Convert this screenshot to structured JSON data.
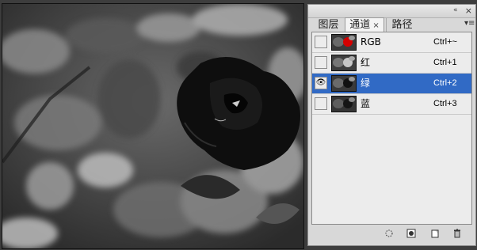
{
  "panel": {
    "tabs": [
      {
        "label": "图层"
      },
      {
        "label": "通道"
      },
      {
        "label": "路径"
      }
    ],
    "tab_close": "×",
    "panel_close": "×",
    "collapse": "«",
    "menu": "▾≡",
    "channels": [
      {
        "name": "RGB",
        "shortcut": "Ctrl+~",
        "visible": false,
        "selected": false
      },
      {
        "name": "红",
        "shortcut": "Ctrl+1",
        "visible": false,
        "selected": false
      },
      {
        "name": "绿",
        "shortcut": "Ctrl+2",
        "visible": true,
        "selected": true
      },
      {
        "name": "蓝",
        "shortcut": "Ctrl+3",
        "visible": false,
        "selected": false
      }
    ],
    "eye_glyph": "👁",
    "bottom_icons": [
      "dotted-circle-icon",
      "mask-icon",
      "new-channel-icon",
      "trash-icon"
    ],
    "colors": {
      "selected": "#316ac5",
      "rose_red": "#d40000"
    }
  }
}
